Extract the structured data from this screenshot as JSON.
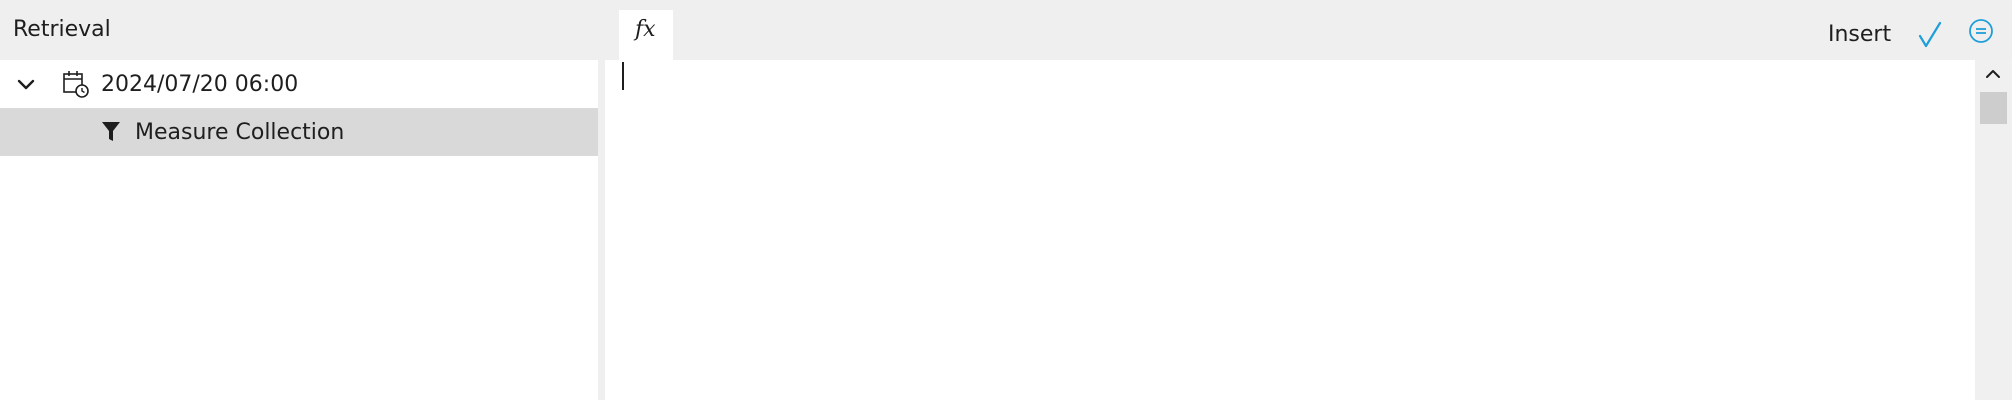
{
  "left_panel": {
    "title": "Retrieval",
    "tree": [
      {
        "label": "2024/07/20 06:00",
        "icon": "calendar-clock-icon",
        "expanded": true
      },
      {
        "label": "Measure Collection",
        "icon": "filter-icon",
        "selected": true
      }
    ]
  },
  "right_panel": {
    "tab_label": "fx",
    "insert_label": "Insert",
    "editor_text": ""
  },
  "colors": {
    "accent": "#1e9fd8",
    "panel_bg": "#efefef",
    "selected_row": "#d9d9d9",
    "editor_bg": "#ffffff"
  }
}
